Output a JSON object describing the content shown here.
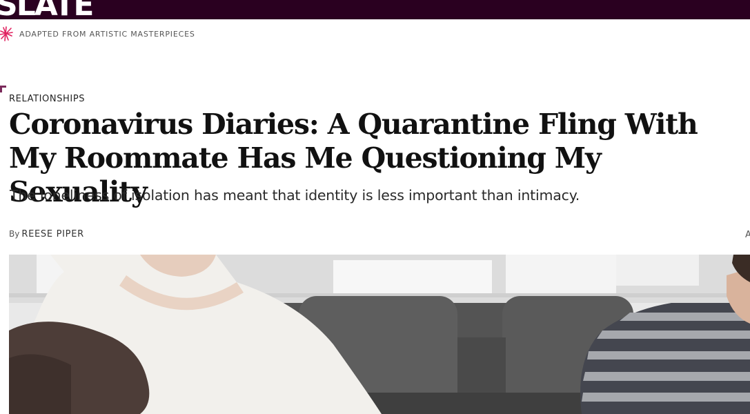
{
  "site": {
    "logo_text": "SLATE",
    "tagline": "ADAPTED FROM ARTISTIC MASTERPIECES",
    "colors": {
      "topbar": "#2a0020",
      "accent": "#e0215f"
    }
  },
  "article": {
    "section": "RELATIONSHIPS",
    "headline": "Coronavirus Diaries: A Quarantine Fling With My Roommate Has Me Questioning My Sexuality",
    "dek": "The loneliness of isolation has meant that identity is less important than intimacy.",
    "byline_prefix": "By",
    "author": "REESE PIPER",
    "edge_letter": "A"
  },
  "hero_image": {
    "description_icon": "photo-couple-on-sofa"
  }
}
